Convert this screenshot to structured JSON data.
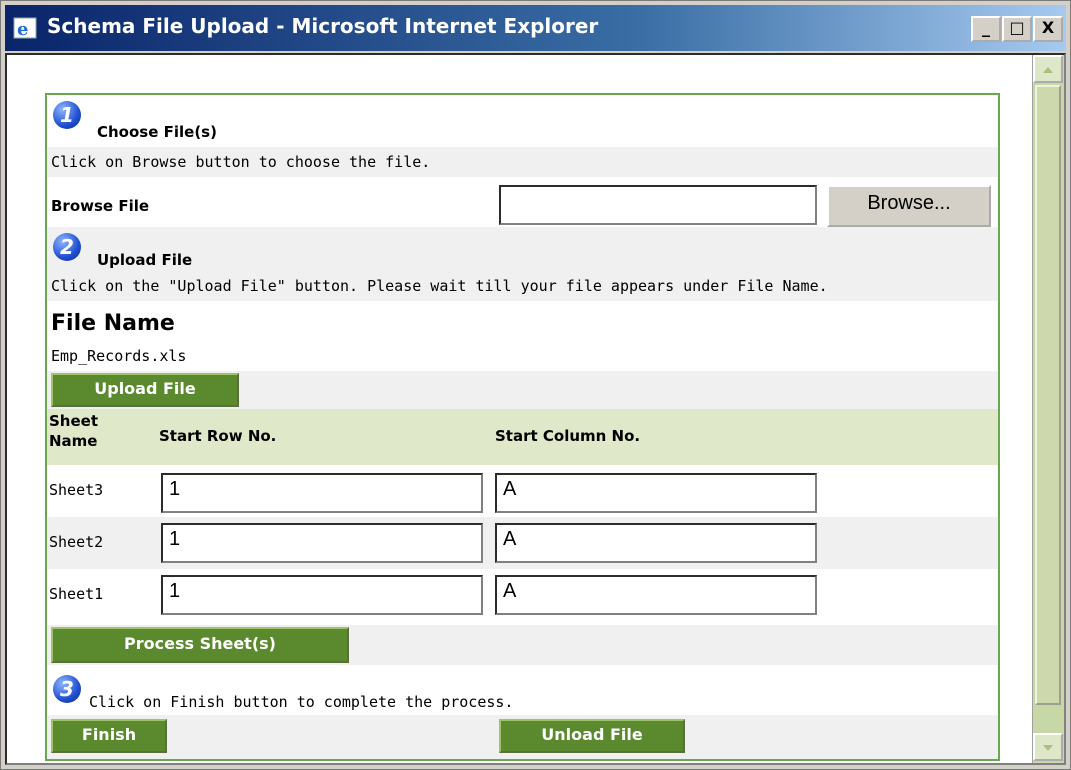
{
  "window": {
    "title": "Schema File Upload - Microsoft Internet Explorer",
    "minimize": "_",
    "maximize": "□",
    "close": "X"
  },
  "steps": {
    "step1": {
      "number": "1",
      "title": "Choose File(s)",
      "hint": "Click on Browse button to choose the file."
    },
    "browse_label": "Browse File",
    "browse_value": "",
    "browse_button": "Browse...",
    "step2": {
      "number": "2",
      "title": "Upload File",
      "hint": "Click on the \"Upload File\" button. Please wait till your file appears under File Name."
    },
    "file_name_header": "File Name",
    "file_name": "Emp_Records.xls",
    "upload_button": "Upload File",
    "table": {
      "headers": {
        "sheet_name": "Sheet\nName",
        "start_row": "Start Row No.",
        "start_col": "Start Column No."
      },
      "rows": [
        {
          "sheet": "Sheet3",
          "row": "1",
          "col": "A"
        },
        {
          "sheet": "Sheet2",
          "row": "1",
          "col": "A"
        },
        {
          "sheet": "Sheet1",
          "row": "1",
          "col": "A"
        }
      ]
    },
    "process_button": "Process Sheet(s)",
    "step3": {
      "number": "3",
      "hint": "Click on Finish button to complete the process."
    },
    "finish_button": "Finish",
    "unload_button": "Unload File"
  },
  "colors": {
    "accent_green": "#5b8a2e",
    "panel_border": "#6aa84f",
    "header_band": "#dfe8c9",
    "titlebar": "#0a246a"
  }
}
